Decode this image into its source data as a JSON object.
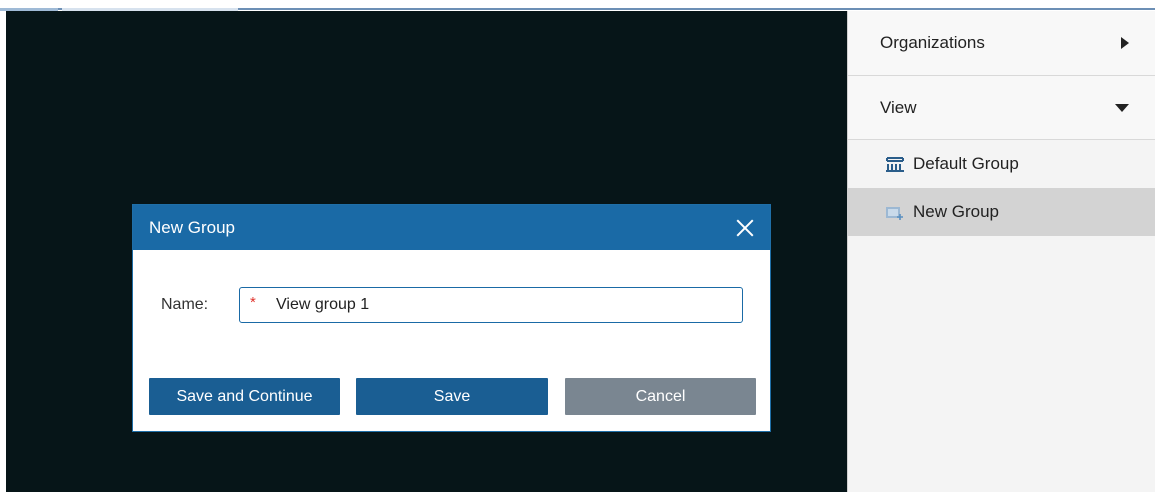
{
  "right_panel": {
    "organizations_label": "Organizations",
    "view_label": "View",
    "tree_items": [
      {
        "label": "Default Group",
        "icon": "group-building-icon"
      },
      {
        "label": "New Group",
        "icon": "new-group-icon",
        "selected": true
      }
    ]
  },
  "dialog": {
    "title": "New Group",
    "name_label": "Name:",
    "required_marker": "*",
    "name_value": "View group 1",
    "buttons": {
      "save_continue": "Save and Continue",
      "save": "Save",
      "cancel": "Cancel"
    }
  },
  "colors": {
    "accent": "#1a6aa6",
    "viewport_bg": "#061518",
    "cancel_bg": "#7a8691"
  }
}
